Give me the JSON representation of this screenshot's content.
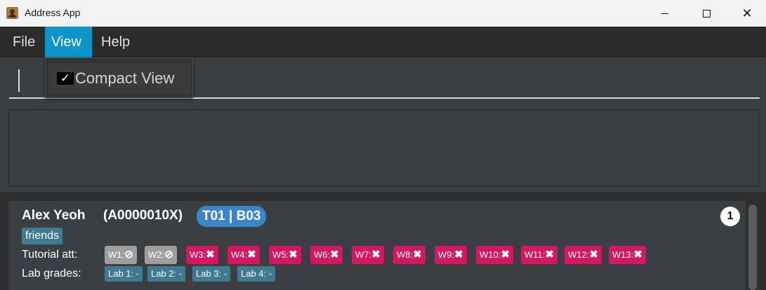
{
  "window": {
    "title": "Address App",
    "icon": "address-book-icon",
    "controls": [
      "minimize-icon",
      "maximize-icon",
      "close-icon"
    ]
  },
  "menu": {
    "file": "File",
    "view": "View",
    "help": "Help"
  },
  "dropdown": {
    "check": "✓",
    "compact_view": "Compact View",
    "compact_view_checked": true
  },
  "command_box": {
    "value": ""
  },
  "result_display": {
    "text": ""
  },
  "colors": {
    "accent": "#0a96c9",
    "absent": "#d6165f",
    "not_applicable": "#9e9e9e",
    "tag": "#3e7b91",
    "group": "#3a86c8"
  },
  "person": {
    "name": "Alex Yeoh",
    "matric": "(A0000010X)",
    "group": "T01 | B03",
    "index": "1",
    "tag": "friends",
    "tutorial_label": "Tutorial att:",
    "lab_label": "Lab grades:",
    "attendance": [
      {
        "label": "W1:",
        "mark": "⊘",
        "status": "na"
      },
      {
        "label": "W2:",
        "mark": "⊘",
        "status": "na"
      },
      {
        "label": "W3:",
        "mark": "✖",
        "status": "absent"
      },
      {
        "label": "W4:",
        "mark": "✖",
        "status": "absent"
      },
      {
        "label": "W5:",
        "mark": "✖",
        "status": "absent"
      },
      {
        "label": "W6:",
        "mark": "✖",
        "status": "absent"
      },
      {
        "label": "W7:",
        "mark": "✖",
        "status": "absent"
      },
      {
        "label": "W8:",
        "mark": "✖",
        "status": "absent"
      },
      {
        "label": "W9:",
        "mark": "✖",
        "status": "absent"
      },
      {
        "label": "W10:",
        "mark": "✖",
        "status": "absent"
      },
      {
        "label": "W11:",
        "mark": "✖",
        "status": "absent"
      },
      {
        "label": "W12:",
        "mark": "✖",
        "status": "absent"
      },
      {
        "label": "W13:",
        "mark": "✖",
        "status": "absent"
      }
    ],
    "labs": [
      "Lab 1: -",
      "Lab 2: -",
      "Lab 3: -",
      "Lab 4: -"
    ]
  }
}
